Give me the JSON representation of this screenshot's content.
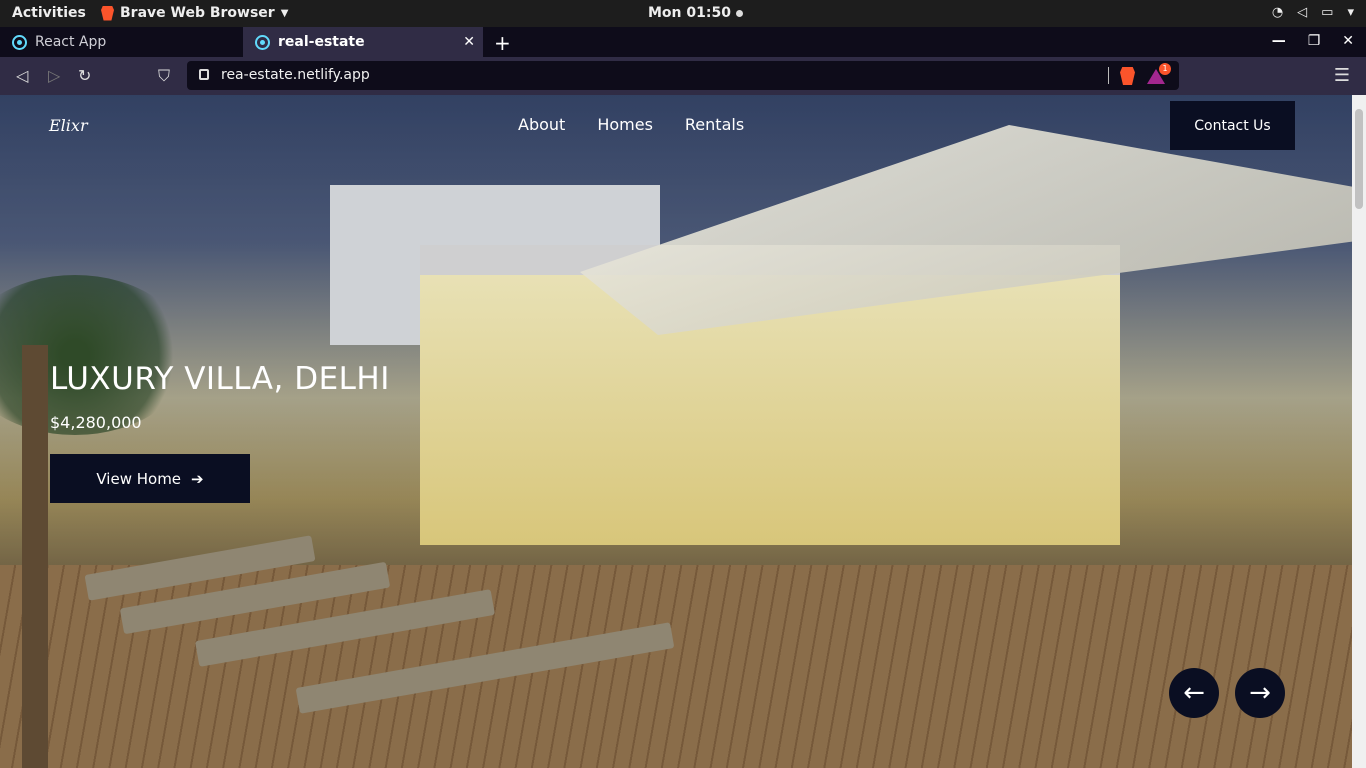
{
  "system": {
    "activities": "Activities",
    "app_name": "Brave Web Browser",
    "clock": "Mon 01:50"
  },
  "browser": {
    "tabs": [
      {
        "label": "React App",
        "active": false
      },
      {
        "label": "real-estate",
        "active": true
      }
    ],
    "url": "rea-estate.netlify.app",
    "rewards_badge": "1"
  },
  "site": {
    "brand": "Elixr",
    "nav": [
      "About",
      "Homes",
      "Rentals"
    ],
    "contact_label": "Contact Us",
    "hero": {
      "title": "LUXURY VILLA, DELHI",
      "price": "$4,280,000",
      "cta_label": "View Home"
    }
  },
  "colors": {
    "button_bg": "#0a0e22",
    "tab_active_bg": "#302c45",
    "brave_orange": "#fb542b"
  }
}
